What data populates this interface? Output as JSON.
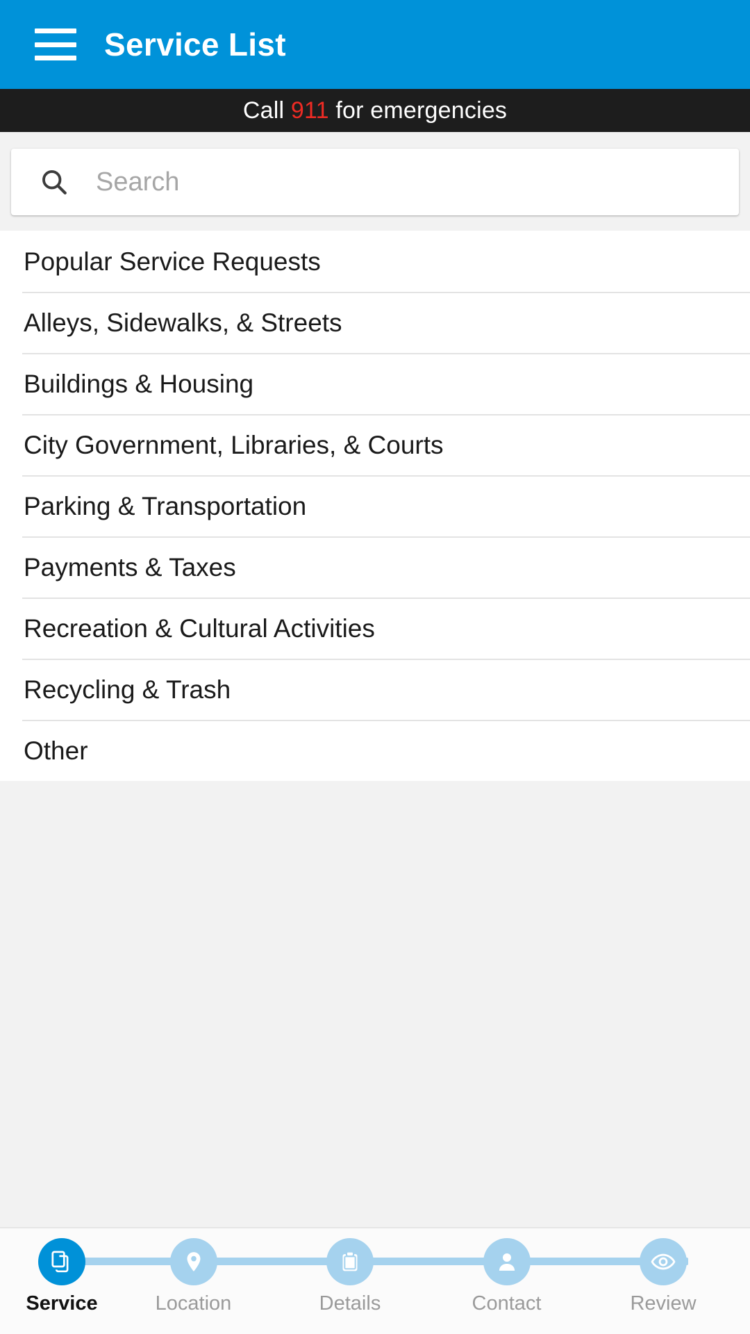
{
  "appbar": {
    "title": "Service List",
    "menu_icon": "hamburger-menu-icon",
    "background_color": "#0092d9"
  },
  "emergency_banner": {
    "prefix": "Call ",
    "number": "911",
    "suffix": " for emergencies",
    "number_color": "#ee2b24",
    "background_color": "#1d1d1d"
  },
  "search": {
    "icon": "search-icon",
    "placeholder": "Search",
    "value": ""
  },
  "service_list": {
    "items": [
      {
        "label": "Popular Service Requests"
      },
      {
        "label": "Alleys, Sidewalks, & Streets"
      },
      {
        "label": "Buildings & Housing"
      },
      {
        "label": "City Government, Libraries, & Courts"
      },
      {
        "label": "Parking & Transportation"
      },
      {
        "label": "Payments & Taxes"
      },
      {
        "label": "Recreation & Cultural Activities"
      },
      {
        "label": "Recycling & Trash"
      },
      {
        "label": "Other"
      }
    ]
  },
  "stepper": {
    "active_index": 0,
    "active_color": "#0091d8",
    "inactive_color": "#a5d2ee",
    "steps": [
      {
        "label": "Service",
        "icon": "documents-icon"
      },
      {
        "label": "Location",
        "icon": "map-pin-icon"
      },
      {
        "label": "Details",
        "icon": "clipboard-icon"
      },
      {
        "label": "Contact",
        "icon": "person-icon"
      },
      {
        "label": "Review",
        "icon": "eye-icon"
      }
    ]
  }
}
